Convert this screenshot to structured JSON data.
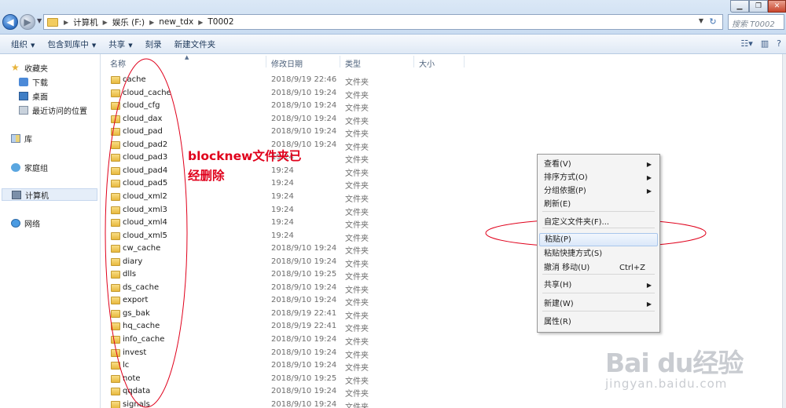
{
  "window": {
    "breadcrumbs": [
      "计算机",
      "娱乐 (F:)",
      "new_tdx",
      "T0002"
    ],
    "search_placeholder": "搜索 T0002",
    "controls": {
      "minimize": "▁",
      "maximize": "❐",
      "close": "✕"
    }
  },
  "toolbar": {
    "items": [
      {
        "label": "组织",
        "has_dropdown": true
      },
      {
        "label": "包含到库中",
        "has_dropdown": true
      },
      {
        "label": "共享",
        "has_dropdown": true
      },
      {
        "label": "刻录",
        "has_dropdown": false
      },
      {
        "label": "新建文件夹",
        "has_dropdown": false
      }
    ]
  },
  "nav": {
    "favorites": "收藏夹",
    "downloads": "下载",
    "desktop": "桌面",
    "recent": "最近访问的位置",
    "libraries": "库",
    "homegroup": "家庭组",
    "computer": "计算机",
    "network": "网络"
  },
  "columns": {
    "name": "名称",
    "date": "修改日期",
    "type": "类型",
    "size": "大小"
  },
  "files": [
    {
      "name": "cache",
      "date": "2018/9/19 22:46",
      "type": "文件夹"
    },
    {
      "name": "cloud_cache",
      "date": "2018/9/10 19:24",
      "type": "文件夹"
    },
    {
      "name": "cloud_cfg",
      "date": "2018/9/10 19:24",
      "type": "文件夹"
    },
    {
      "name": "cloud_dax",
      "date": "2018/9/10 19:24",
      "type": "文件夹"
    },
    {
      "name": "cloud_pad",
      "date": "2018/9/10 19:24",
      "type": "文件夹"
    },
    {
      "name": "cloud_pad2",
      "date": "2018/9/10 19:24",
      "type": "文件夹"
    },
    {
      "name": "cloud_pad3",
      "date": "19:24",
      "type": "文件夹"
    },
    {
      "name": "cloud_pad4",
      "date": "19:24",
      "type": "文件夹"
    },
    {
      "name": "cloud_pad5",
      "date": "19:24",
      "type": "文件夹"
    },
    {
      "name": "cloud_xml2",
      "date": "19:24",
      "type": "文件夹"
    },
    {
      "name": "cloud_xml3",
      "date": "19:24",
      "type": "文件夹"
    },
    {
      "name": "cloud_xml4",
      "date": "19:24",
      "type": "文件夹"
    },
    {
      "name": "cloud_xml5",
      "date": "19:24",
      "type": "文件夹"
    },
    {
      "name": "cw_cache",
      "date": "2018/9/10 19:24",
      "type": "文件夹"
    },
    {
      "name": "diary",
      "date": "2018/9/10 19:24",
      "type": "文件夹"
    },
    {
      "name": "dlls",
      "date": "2018/9/10 19:25",
      "type": "文件夹"
    },
    {
      "name": "ds_cache",
      "date": "2018/9/10 19:24",
      "type": "文件夹"
    },
    {
      "name": "export",
      "date": "2018/9/10 19:24",
      "type": "文件夹"
    },
    {
      "name": "gs_bak",
      "date": "2018/9/19 22:41",
      "type": "文件夹"
    },
    {
      "name": "hq_cache",
      "date": "2018/9/19 22:41",
      "type": "文件夹"
    },
    {
      "name": "info_cache",
      "date": "2018/9/10 19:24",
      "type": "文件夹"
    },
    {
      "name": "invest",
      "date": "2018/9/10 19:24",
      "type": "文件夹"
    },
    {
      "name": "lc",
      "date": "2018/9/10 19:24",
      "type": "文件夹"
    },
    {
      "name": "note",
      "date": "2018/9/10 19:25",
      "type": "文件夹"
    },
    {
      "name": "qqdata",
      "date": "2018/9/10 19:24",
      "type": "文件夹"
    },
    {
      "name": "signals",
      "date": "2018/9/10 19:24",
      "type": "文件夹"
    }
  ],
  "annotation": {
    "text": "blocknew文件夹已经删除",
    "color": "#e0001b"
  },
  "context_menu": {
    "items": [
      {
        "label": "查看(V)",
        "submenu": true
      },
      {
        "label": "排序方式(O)",
        "submenu": true
      },
      {
        "label": "分组依据(P)",
        "submenu": true
      },
      {
        "label": "刷新(E)"
      },
      {
        "label": "自定义文件夹(F)..."
      },
      {
        "label": "粘贴(P)",
        "highlighted": true
      },
      {
        "label": "粘贴快捷方式(S)"
      },
      {
        "label": "撤消 移动(U)",
        "shortcut": "Ctrl+Z"
      },
      {
        "label": "共享(H)",
        "submenu": true
      },
      {
        "label": "新建(W)",
        "submenu": true
      },
      {
        "label": "属性(R)"
      }
    ]
  },
  "watermark": {
    "logo": "Bai du经验",
    "url": "jingyan.baidu.com"
  }
}
